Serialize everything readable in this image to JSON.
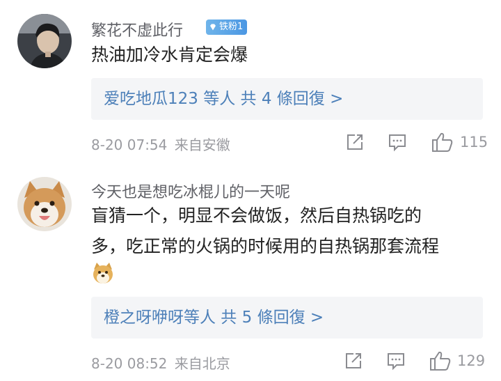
{
  "comments": [
    {
      "username": "繁花不虚此行",
      "badge": "铁粉1",
      "text": "热油加冷水肯定会爆",
      "reply_summary": "爱吃地瓜123 等人 共 4 條回復 >",
      "timestamp": "8-20 07:54",
      "location": "来自安徽",
      "likes": "115",
      "avatar_icon": "user-avatar-portrait"
    },
    {
      "username": "今天也是想吃冰棍儿的一天呢",
      "text_line1": "盲猜一个，明显不会做饭，然后自热锅吃的",
      "text_line2": "多，吃正常的火锅的时候用的自热锅那套流程",
      "emoji": "doge-emoji",
      "reply_summary": "橙之呀咿呀等人 共 5 條回復 >",
      "timestamp": "8-20 08:52",
      "location": "来自北京",
      "likes": "129",
      "avatar_icon": "shiba-dog-avatar"
    }
  ],
  "icons": {
    "share": "share-icon",
    "comment": "comment-icon",
    "like": "thumbs-up-icon"
  },
  "colors": {
    "reply_link": "#4d80b9",
    "badge": "#5aa5e8",
    "meta": "#9a9ba0"
  }
}
